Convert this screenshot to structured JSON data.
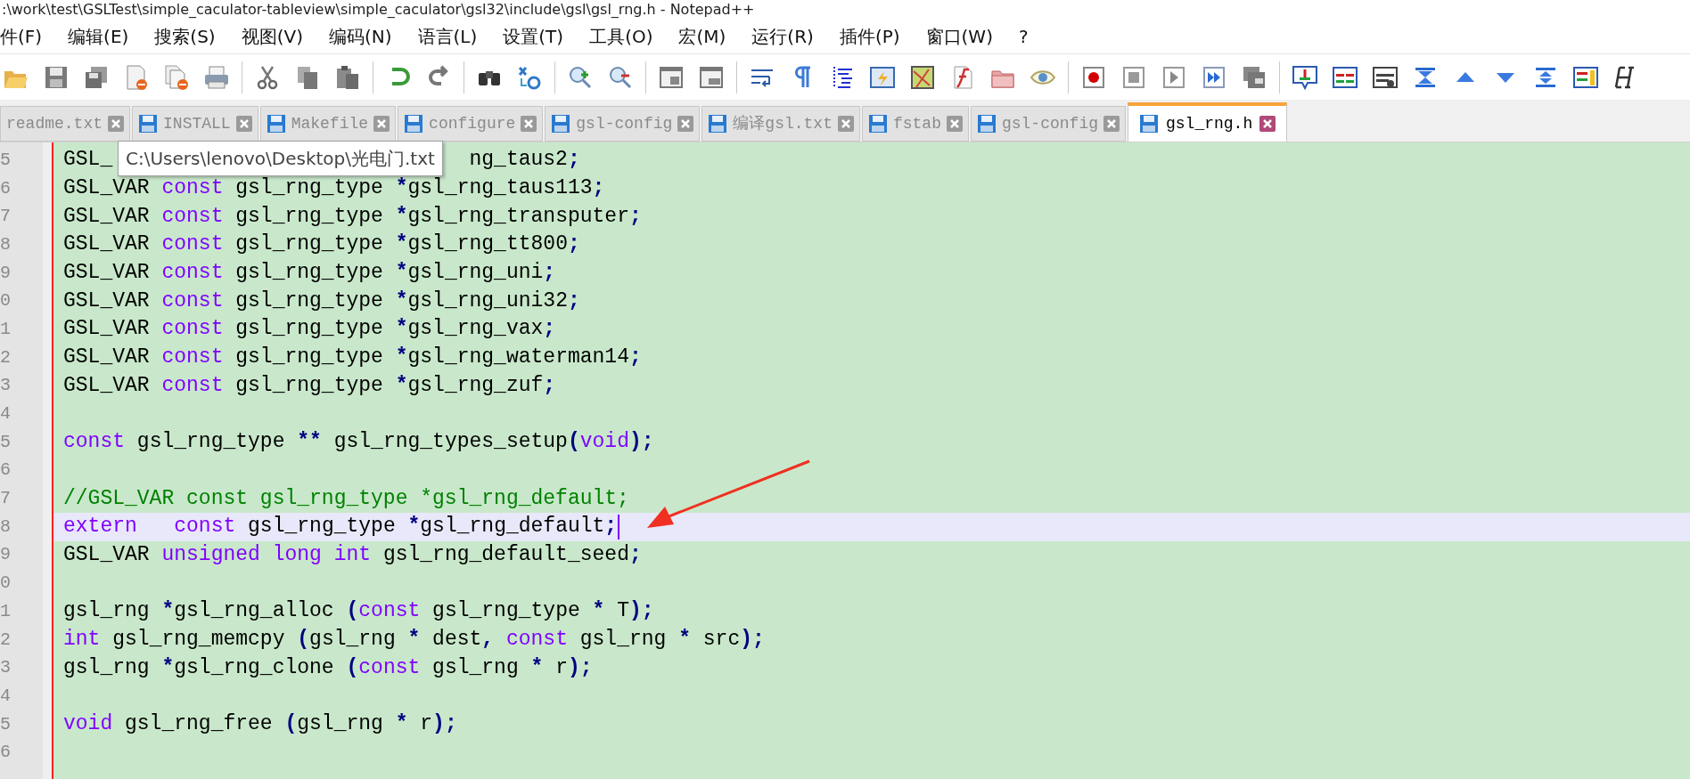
{
  "title_bar": {
    "title": ":\\work\\test\\GSLTest\\simple_caculator-tableview\\simple_caculator\\gsl32\\include\\gsl\\gsl_rng.h - Notepad++"
  },
  "menu": [
    {
      "label": "件(F)"
    },
    {
      "label": "编辑(E)"
    },
    {
      "label": "搜索(S)"
    },
    {
      "label": "视图(V)"
    },
    {
      "label": "编码(N)"
    },
    {
      "label": "语言(L)"
    },
    {
      "label": "设置(T)"
    },
    {
      "label": "工具(O)"
    },
    {
      "label": "宏(M)"
    },
    {
      "label": "运行(R)"
    },
    {
      "label": "插件(P)"
    },
    {
      "label": "窗口(W)"
    },
    {
      "label": "?"
    }
  ],
  "tabs": [
    {
      "label": "readme.txt",
      "selected": false,
      "icon": false
    },
    {
      "label": "INSTALL",
      "selected": false,
      "icon": true
    },
    {
      "label": "Makefile",
      "selected": false,
      "icon": true
    },
    {
      "label": "configure",
      "selected": false,
      "icon": true
    },
    {
      "label": "gsl-config",
      "selected": false,
      "icon": true
    },
    {
      "label": "编译gsl.txt",
      "selected": false,
      "icon": true
    },
    {
      "label": "fstab",
      "selected": false,
      "icon": true
    },
    {
      "label": "gsl-config",
      "selected": false,
      "icon": true
    },
    {
      "label": "gsl_rng.h",
      "selected": true,
      "icon": true
    }
  ],
  "editor": {
    "tooltip": {
      "text": "C:\\Users\\lenovo\\Desktop\\光电门.txt"
    },
    "lines": [
      {
        "number": "5",
        "current": false,
        "tokens": [
          {
            "text": "GSL_",
            "kind": "p"
          },
          {
            "text": "ng_taus2",
            "kind": "behind"
          },
          {
            "text": ";",
            "kind": "o"
          }
        ]
      },
      {
        "number": "6",
        "current": false,
        "tokens": [
          {
            "text": "GSL_VAR ",
            "kind": "p"
          },
          {
            "text": "const ",
            "kind": "k"
          },
          {
            "text": "gsl_rng_type ",
            "kind": "p"
          },
          {
            "text": "*",
            "kind": "o"
          },
          {
            "text": "gsl_rng_taus113",
            "kind": "p"
          },
          {
            "text": ";",
            "kind": "o"
          }
        ]
      },
      {
        "number": "7",
        "current": false,
        "tokens": [
          {
            "text": "GSL_VAR ",
            "kind": "p"
          },
          {
            "text": "const ",
            "kind": "k"
          },
          {
            "text": "gsl_rng_type ",
            "kind": "p"
          },
          {
            "text": "*",
            "kind": "o"
          },
          {
            "text": "gsl_rng_transputer",
            "kind": "p"
          },
          {
            "text": ";",
            "kind": "o"
          }
        ]
      },
      {
        "number": "8",
        "current": false,
        "tokens": [
          {
            "text": "GSL_VAR ",
            "kind": "p"
          },
          {
            "text": "const ",
            "kind": "k"
          },
          {
            "text": "gsl_rng_type ",
            "kind": "p"
          },
          {
            "text": "*",
            "kind": "o"
          },
          {
            "text": "gsl_rng_tt800",
            "kind": "p"
          },
          {
            "text": ";",
            "kind": "o"
          }
        ]
      },
      {
        "number": "9",
        "current": false,
        "tokens": [
          {
            "text": "GSL_VAR ",
            "kind": "p"
          },
          {
            "text": "const ",
            "kind": "k"
          },
          {
            "text": "gsl_rng_type ",
            "kind": "p"
          },
          {
            "text": "*",
            "kind": "o"
          },
          {
            "text": "gsl_rng_uni",
            "kind": "p"
          },
          {
            "text": ";",
            "kind": "o"
          }
        ]
      },
      {
        "number": "0",
        "current": false,
        "tokens": [
          {
            "text": "GSL_VAR ",
            "kind": "p"
          },
          {
            "text": "const ",
            "kind": "k"
          },
          {
            "text": "gsl_rng_type ",
            "kind": "p"
          },
          {
            "text": "*",
            "kind": "o"
          },
          {
            "text": "gsl_rng_uni32",
            "kind": "p"
          },
          {
            "text": ";",
            "kind": "o"
          }
        ]
      },
      {
        "number": "1",
        "current": false,
        "tokens": [
          {
            "text": "GSL_VAR ",
            "kind": "p"
          },
          {
            "text": "const ",
            "kind": "k"
          },
          {
            "text": "gsl_rng_type ",
            "kind": "p"
          },
          {
            "text": "*",
            "kind": "o"
          },
          {
            "text": "gsl_rng_vax",
            "kind": "p"
          },
          {
            "text": ";",
            "kind": "o"
          }
        ]
      },
      {
        "number": "2",
        "current": false,
        "tokens": [
          {
            "text": "GSL_VAR ",
            "kind": "p"
          },
          {
            "text": "const ",
            "kind": "k"
          },
          {
            "text": "gsl_rng_type ",
            "kind": "p"
          },
          {
            "text": "*",
            "kind": "o"
          },
          {
            "text": "gsl_rng_waterman14",
            "kind": "p"
          },
          {
            "text": ";",
            "kind": "o"
          }
        ]
      },
      {
        "number": "3",
        "current": false,
        "tokens": [
          {
            "text": "GSL_VAR ",
            "kind": "p"
          },
          {
            "text": "const ",
            "kind": "k"
          },
          {
            "text": "gsl_rng_type ",
            "kind": "p"
          },
          {
            "text": "*",
            "kind": "o"
          },
          {
            "text": "gsl_rng_zuf",
            "kind": "p"
          },
          {
            "text": ";",
            "kind": "o"
          }
        ]
      },
      {
        "number": "4",
        "current": false
      },
      {
        "number": "5",
        "current": false,
        "tokens": [
          {
            "text": "const ",
            "kind": "k"
          },
          {
            "text": "gsl_rng_type ",
            "kind": "p"
          },
          {
            "text": "**",
            "kind": "o"
          },
          {
            "text": " gsl_rng_types_setup",
            "kind": "p"
          },
          {
            "text": "(",
            "kind": "o"
          },
          {
            "text": "void",
            "kind": "k"
          },
          {
            "text": ");",
            "kind": "o"
          }
        ]
      },
      {
        "number": "6",
        "current": false
      },
      {
        "number": "7",
        "current": false,
        "tokens": [
          {
            "text": "//GSL_VAR const gsl_rng_type *gsl_rng_default;",
            "kind": "c"
          }
        ]
      },
      {
        "number": "8",
        "current": true,
        "tokens": [
          {
            "text": "extern   ",
            "kind": "k"
          },
          {
            "text": "const ",
            "kind": "k"
          },
          {
            "text": "gsl_rng_type ",
            "kind": "p"
          },
          {
            "text": "*",
            "kind": "o"
          },
          {
            "text": "gsl_rng_default",
            "kind": "p"
          },
          {
            "text": ";",
            "kind": "o"
          }
        ]
      },
      {
        "number": "9",
        "current": false,
        "tokens": [
          {
            "text": "GSL_VAR ",
            "kind": "p"
          },
          {
            "text": "unsigned ",
            "kind": "k"
          },
          {
            "text": "long ",
            "kind": "k"
          },
          {
            "text": "int ",
            "kind": "k"
          },
          {
            "text": "gsl_rng_default_seed",
            "kind": "p"
          },
          {
            "text": ";",
            "kind": "o"
          }
        ]
      },
      {
        "number": "0",
        "current": false
      },
      {
        "number": "1",
        "current": false,
        "tokens": [
          {
            "text": "gsl_rng ",
            "kind": "p"
          },
          {
            "text": "*",
            "kind": "o"
          },
          {
            "text": "gsl_rng_alloc ",
            "kind": "p"
          },
          {
            "text": "(",
            "kind": "o"
          },
          {
            "text": "const ",
            "kind": "k"
          },
          {
            "text": "gsl_rng_type ",
            "kind": "p"
          },
          {
            "text": "*",
            "kind": "o"
          },
          {
            "text": " T",
            "kind": "p"
          },
          {
            "text": ");",
            "kind": "o"
          }
        ]
      },
      {
        "number": "2",
        "current": false,
        "tokens": [
          {
            "text": "int ",
            "kind": "k"
          },
          {
            "text": "gsl_rng_memcpy ",
            "kind": "p"
          },
          {
            "text": "(",
            "kind": "o"
          },
          {
            "text": "gsl_rng ",
            "kind": "p"
          },
          {
            "text": "*",
            "kind": "o"
          },
          {
            "text": " dest",
            "kind": "p"
          },
          {
            "text": ", ",
            "kind": "o"
          },
          {
            "text": "const ",
            "kind": "k"
          },
          {
            "text": "gsl_rng ",
            "kind": "p"
          },
          {
            "text": "*",
            "kind": "o"
          },
          {
            "text": " src",
            "kind": "p"
          },
          {
            "text": ");",
            "kind": "o"
          }
        ]
      },
      {
        "number": "3",
        "current": false,
        "tokens": [
          {
            "text": "gsl_rng ",
            "kind": "p"
          },
          {
            "text": "*",
            "kind": "o"
          },
          {
            "text": "gsl_rng_clone ",
            "kind": "p"
          },
          {
            "text": "(",
            "kind": "o"
          },
          {
            "text": "const ",
            "kind": "k"
          },
          {
            "text": "gsl_rng ",
            "kind": "p"
          },
          {
            "text": "*",
            "kind": "o"
          },
          {
            "text": " r",
            "kind": "p"
          },
          {
            "text": ");",
            "kind": "o"
          }
        ]
      },
      {
        "number": "4",
        "current": false
      },
      {
        "number": "5",
        "current": false,
        "tokens": [
          {
            "text": "void ",
            "kind": "k"
          },
          {
            "text": "gsl_rng_free ",
            "kind": "p"
          },
          {
            "text": "(",
            "kind": "o"
          },
          {
            "text": "gsl_rng ",
            "kind": "p"
          },
          {
            "text": "*",
            "kind": "o"
          },
          {
            "text": " r",
            "kind": "p"
          },
          {
            "text": ");",
            "kind": "o"
          }
        ]
      },
      {
        "number": "6",
        "current": false
      }
    ]
  }
}
